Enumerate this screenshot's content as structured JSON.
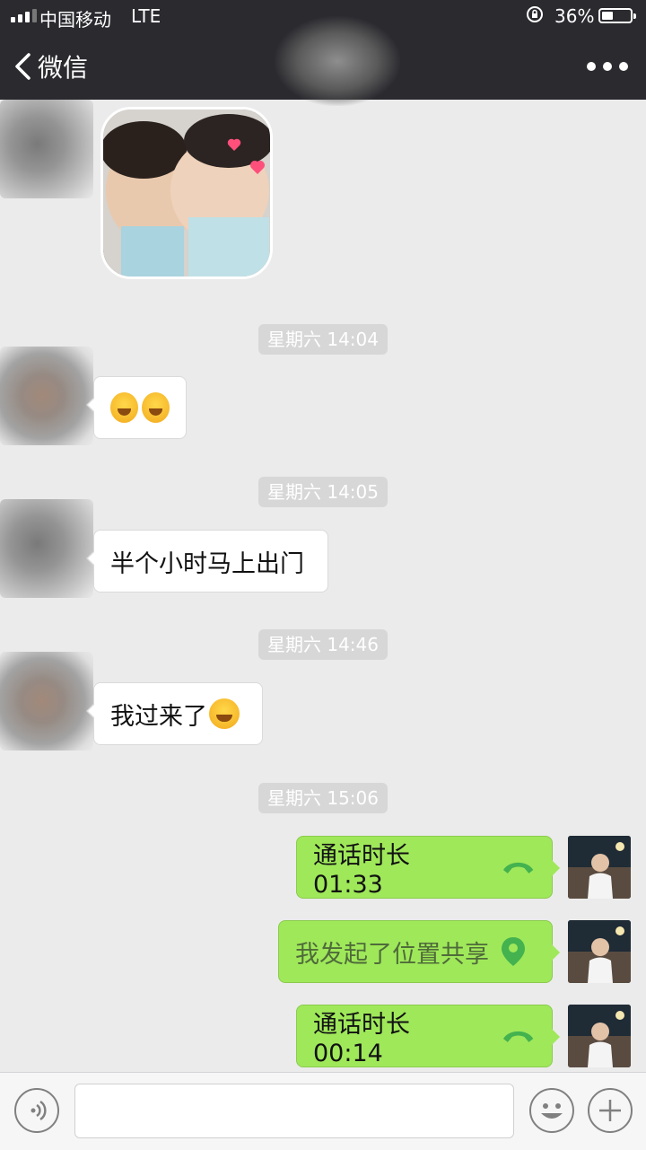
{
  "status_bar": {
    "carrier": "中国移动",
    "network": "LTE",
    "battery_percent": "36%",
    "battery_level": 0.36
  },
  "nav": {
    "back_label": "微信"
  },
  "messages": {
    "time_1": "星期六 14:04",
    "msg_1_emoji": [
      "loudly-crying-face",
      "loudly-crying-face"
    ],
    "time_2": "星期六 14:05",
    "msg_2_text": "半个小时马上出门",
    "time_3": "星期六 14:46",
    "msg_3_text": "我过来了",
    "msg_3_emoji": "face-with-tears-of-joy",
    "time_4": "星期六 15:06",
    "call_1_text": "通话时长 01:33",
    "location_share_text": "我发起了位置共享",
    "call_2_text": "通话时长 00:14"
  },
  "colors": {
    "top_bar": "#2b2a2f",
    "chat_bg": "#ebebeb",
    "sent_bubble": "#9fe85a",
    "icon_green": "#43b24f"
  }
}
